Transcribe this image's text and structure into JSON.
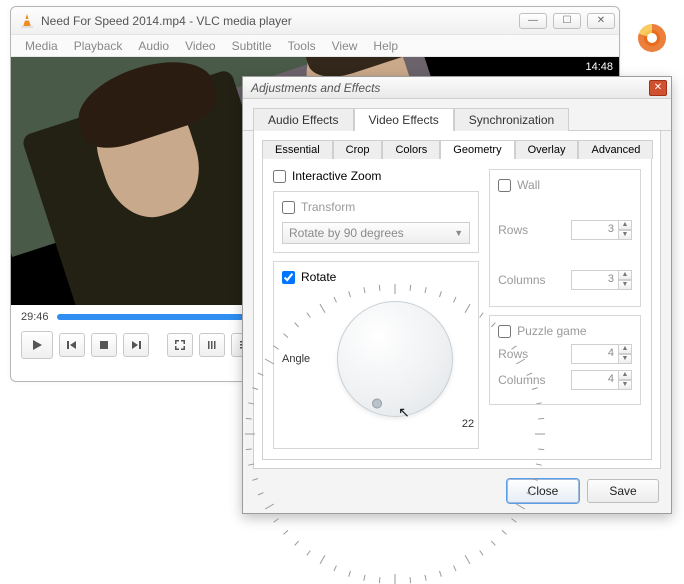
{
  "vlc": {
    "title": "Need For Speed 2014.mp4 - VLC media player",
    "menus": [
      "Media",
      "Playback",
      "Audio",
      "Video",
      "Subtitle",
      "Tools",
      "View",
      "Help"
    ],
    "overlay_time": "14:48",
    "elapsed": "29:46"
  },
  "dialog": {
    "title": "Adjustments and Effects",
    "tabs": {
      "audio": "Audio Effects",
      "video": "Video Effects",
      "sync": "Synchronization",
      "active": "video"
    },
    "subtabs": {
      "items": [
        "Essential",
        "Crop",
        "Colors",
        "Geometry",
        "Overlay",
        "Advanced"
      ],
      "active": "Geometry"
    },
    "geometry": {
      "interactive_zoom": {
        "label": "Interactive Zoom",
        "checked": false
      },
      "transform": {
        "label": "Transform",
        "checked": false,
        "option": "Rotate by 90 degrees"
      },
      "rotate": {
        "label": "Rotate",
        "checked": true,
        "angle_label": "Angle",
        "angle_value": 22
      },
      "wall": {
        "label": "Wall",
        "checked": false,
        "rows_label": "Rows",
        "rows": 3,
        "cols_label": "Columns",
        "cols": 3
      },
      "puzzle": {
        "label": "Puzzle game",
        "checked": false,
        "rows_label": "Rows",
        "rows": 4,
        "cols_label": "Columns",
        "cols": 4
      }
    },
    "buttons": {
      "close": "Close",
      "save": "Save"
    }
  }
}
